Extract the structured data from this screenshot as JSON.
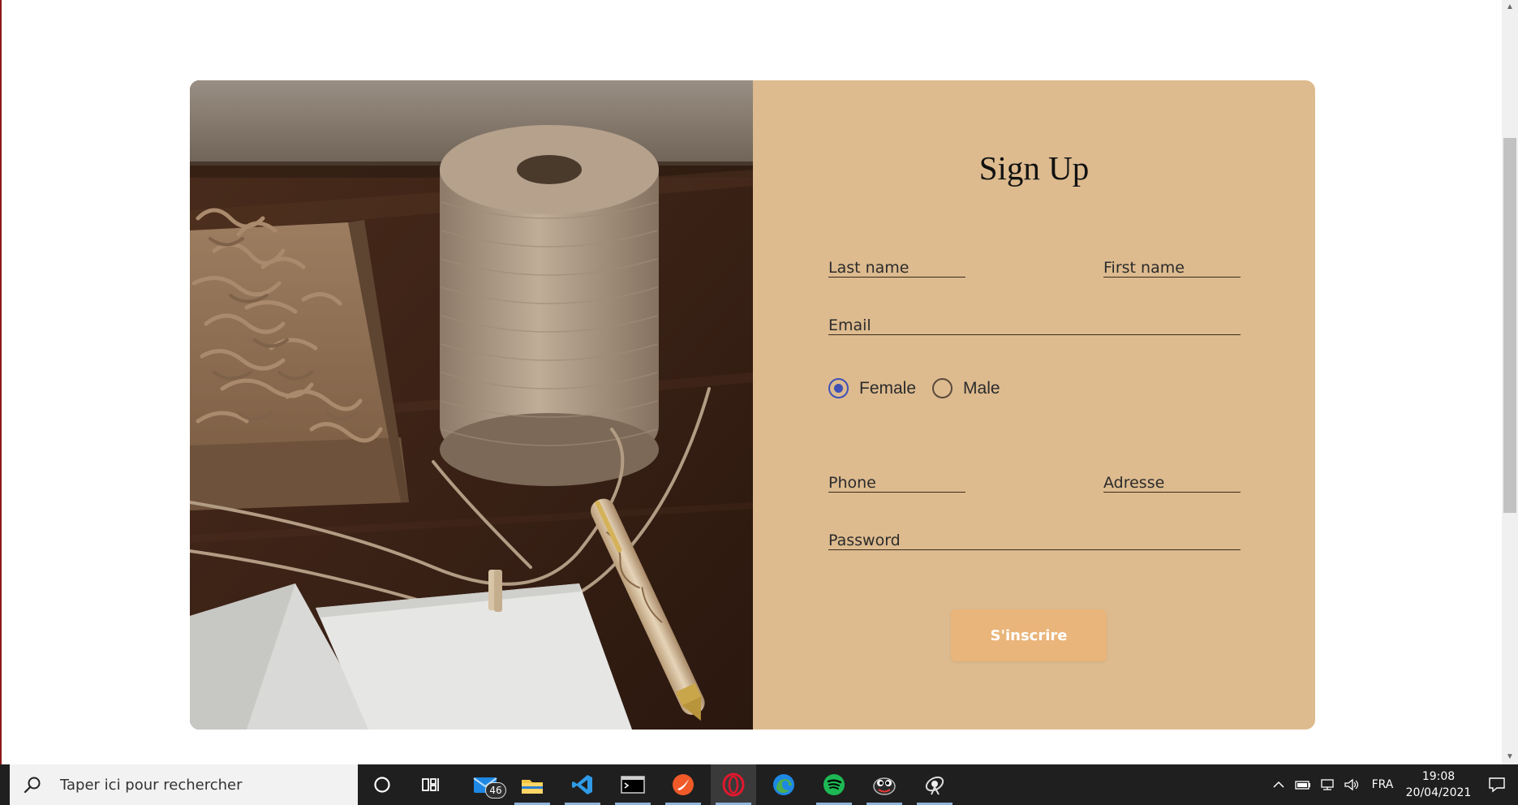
{
  "form": {
    "title": "Sign Up",
    "last_name_placeholder": "Last name",
    "first_name_placeholder": "First name",
    "email_placeholder": "Email",
    "gender_options": [
      "Female",
      "Male"
    ],
    "gender_selected": "Female",
    "phone_placeholder": "Phone",
    "address_placeholder": "Adresse",
    "password_placeholder": "Password",
    "submit_label": "S'inscrire"
  },
  "colors": {
    "form_background": "#ddbb8f",
    "button_background": "#eab57a",
    "radio_accent": "#3f51b5"
  },
  "taskbar": {
    "search_placeholder": "Taper ici pour rechercher",
    "apps": [
      "cortana-icon",
      "task-view-icon",
      "mail-icon",
      "file-explorer-icon",
      "vscode-icon",
      "terminal-icon",
      "swift-app-icon",
      "opera-icon",
      "edge-icon",
      "spotify-icon",
      "game-app-icon",
      "satellite-app-icon"
    ],
    "mail_badge": "46",
    "language": "FRA",
    "time": "19:08",
    "date": "20/04/2021"
  }
}
